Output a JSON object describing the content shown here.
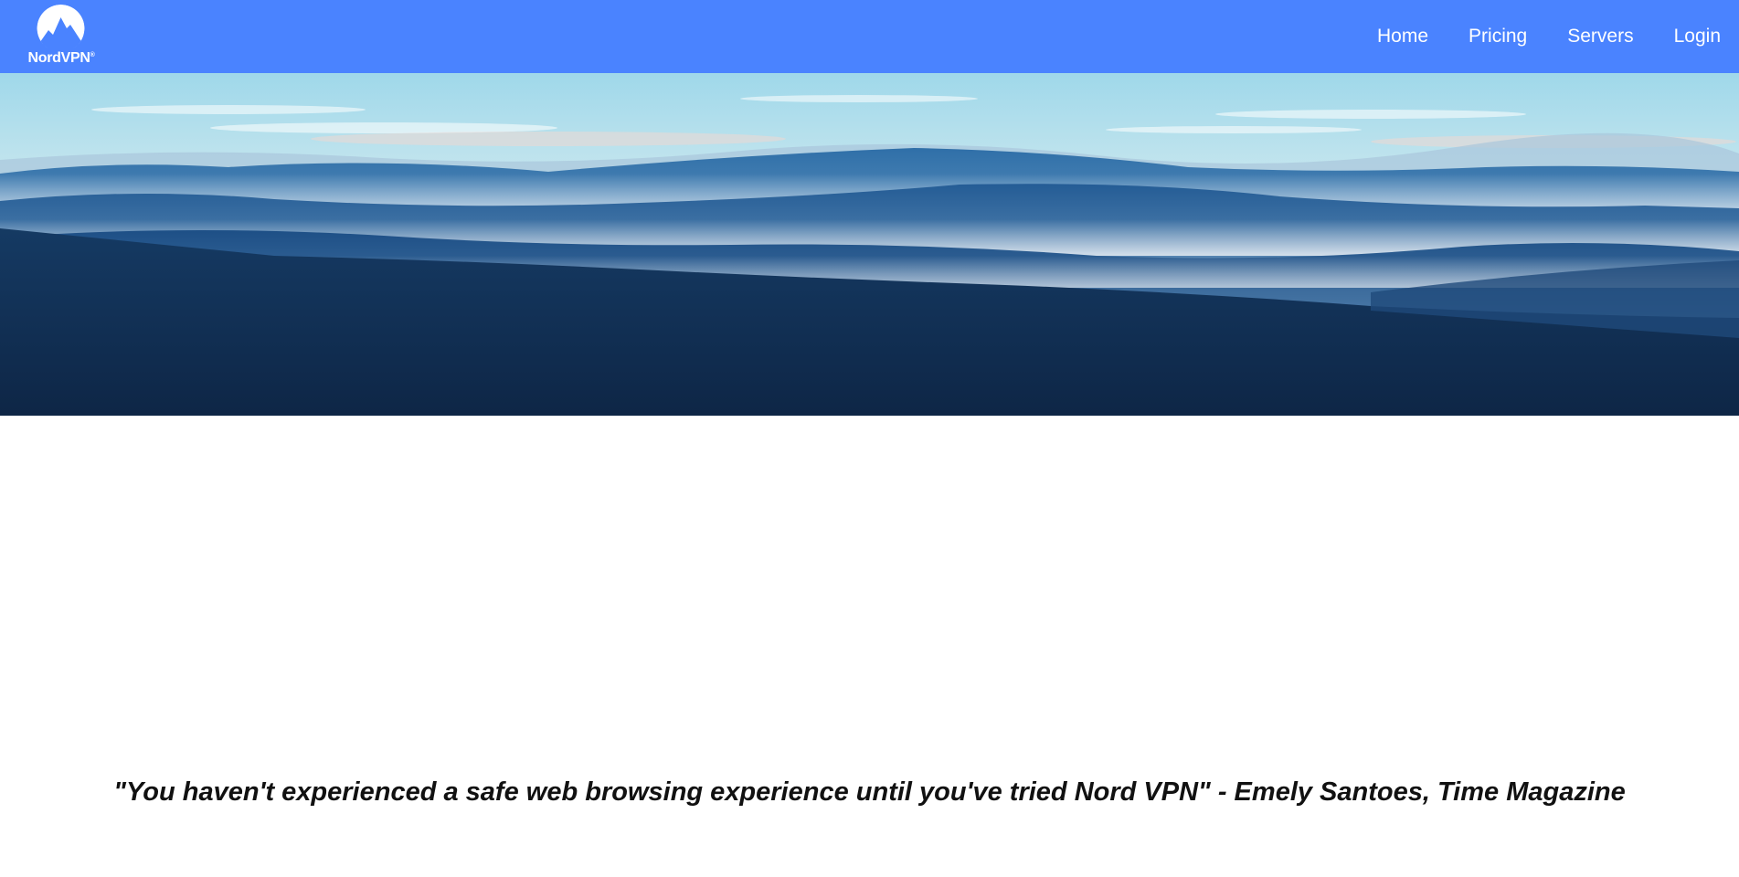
{
  "brand": {
    "name": "NordVPN",
    "registered_mark": "®",
    "logo_icon": "mountain-circle-icon"
  },
  "nav": {
    "items": [
      {
        "label": "Home"
      },
      {
        "label": "Pricing"
      },
      {
        "label": "Servers"
      },
      {
        "label": "Login"
      }
    ]
  },
  "hero": {
    "image": "misty-blue-mountain-landscape"
  },
  "testimonial": {
    "quote": "\"You haven't experienced a safe web browsing experience until you've tried Nord VPN\" - Emely Santoes, Time Magazine"
  },
  "colors": {
    "navbar": "#4a83ff",
    "nav_text": "#ffffff",
    "quote_text": "#111111"
  }
}
